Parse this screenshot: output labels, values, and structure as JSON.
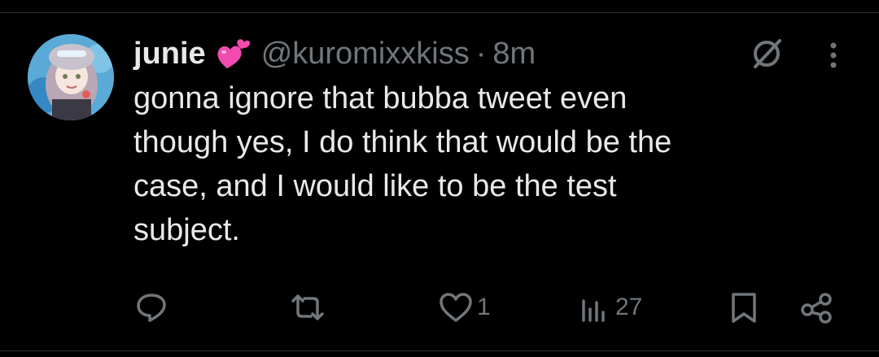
{
  "tweet": {
    "author": {
      "display_name": "junie",
      "handle": "@kuromixxkiss",
      "name_emoji": "two-hearts-emoji"
    },
    "separator": "·",
    "time": "8m",
    "text_lines": [
      "gonna ignore that bubba tweet even",
      "though yes, I do think that would be the",
      "case, and I would like to be the test",
      "subject."
    ],
    "actions": {
      "reply_icon": "reply-icon",
      "retweet_icon": "retweet-icon",
      "like_icon": "heart-icon",
      "like_count": "1",
      "views_icon": "views-icon",
      "views_count": "27",
      "bookmark_icon": "bookmark-icon",
      "share_icon": "share-icon"
    }
  },
  "colors": {
    "background": "#000000",
    "text_primary": "#e7e9ea",
    "text_secondary": "#71767b",
    "divider": "#2f3336",
    "emoji_pink": "#f24bb0"
  }
}
